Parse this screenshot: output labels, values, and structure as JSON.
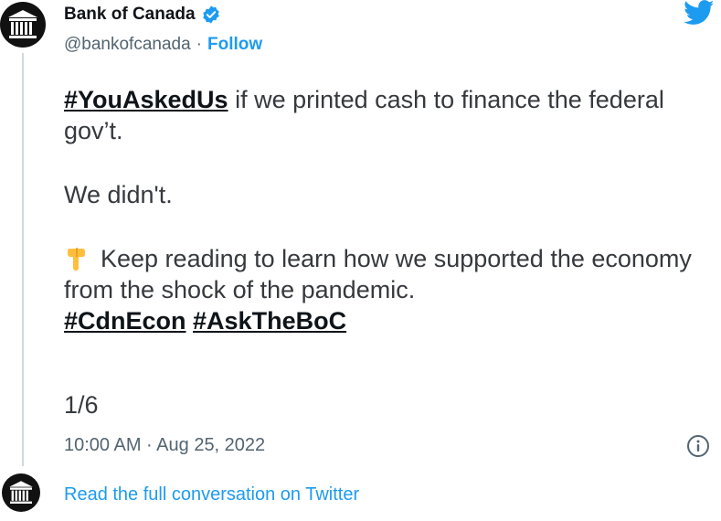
{
  "account": {
    "name": "Bank of Canada",
    "handle": "@bankofcanada",
    "separator": "·",
    "follow_label": "Follow",
    "verified_icon": "verified-badge-icon",
    "avatar_icon": "bank-building-icon"
  },
  "brand": {
    "logo_icon": "twitter-bird-icon",
    "accent": "#1d9bf0"
  },
  "tweet": {
    "hashtag_1": "#YouAskedUs",
    "line_1_rest": " if we printed cash to finance the federal gov’t.",
    "line_2": "We didn't.",
    "emoji_icon": "backhand-index-pointing-down-icon",
    "line_3": "Keep reading to learn how we supported the economy from the shock of the pandemic.",
    "hashtag_2": "#CdnEcon",
    "hashtag_3": "#AskTheBoC",
    "counter": "1/6",
    "timestamp": "10:00 AM · Aug 25, 2022",
    "info_icon": "info-icon"
  },
  "footer": {
    "read_link": "Read the full conversation on Twitter"
  }
}
